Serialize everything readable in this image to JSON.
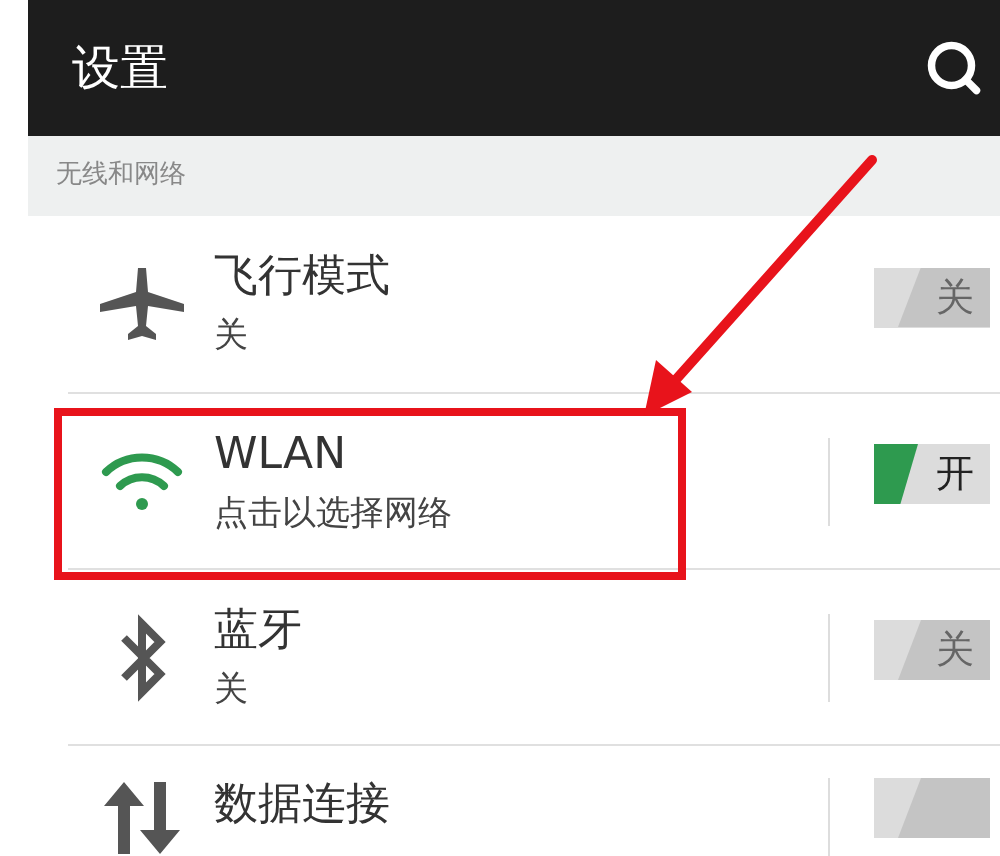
{
  "header": {
    "title": "设置"
  },
  "section": {
    "title": "无线和网络"
  },
  "rows": [
    {
      "kind": "airplane",
      "title": "飞行模式",
      "subtitle": "关",
      "toggle": {
        "on": false,
        "label": "关"
      },
      "divider": false
    },
    {
      "kind": "wifi",
      "title": "WLAN",
      "subtitle": "点击以选择网络",
      "toggle": {
        "on": true,
        "label": "开"
      },
      "divider": true
    },
    {
      "kind": "bluetooth",
      "title": "蓝牙",
      "subtitle": "关",
      "toggle": {
        "on": false,
        "label": "关"
      },
      "divider": true
    },
    {
      "kind": "data",
      "title": "数据连接",
      "toggle": {
        "on": false
      },
      "divider": true
    }
  ]
}
